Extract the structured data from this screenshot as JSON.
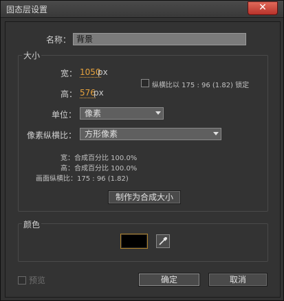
{
  "window": {
    "title": "固态层设置",
    "close_symbol": "✕"
  },
  "name_field": {
    "label": "名称：",
    "value": "背景"
  },
  "size": {
    "legend": "大小",
    "width_label": "宽：",
    "width_value": "1050",
    "height_label": "高：",
    "height_value": "576",
    "unit_px": "px",
    "lock_label": "纵横比以 175 : 96 (1.82) 锁定",
    "units_label": "单位：",
    "units_value": "像素",
    "pixel_aspect_label": "像素纵横比：",
    "pixel_aspect_value": "方形像素",
    "info_width": "宽：合成百分比 100.0%",
    "info_height": "高：合成百分比 100.0%",
    "info_frame": "画面纵横比：175 : 96 (1.82)",
    "make_comp_size_button": "制作为合成大小"
  },
  "color": {
    "legend": "颜色",
    "swatch_hex": "#000000"
  },
  "footer": {
    "preview_label": "预览",
    "ok_button": "确定",
    "cancel_button": "取消"
  }
}
